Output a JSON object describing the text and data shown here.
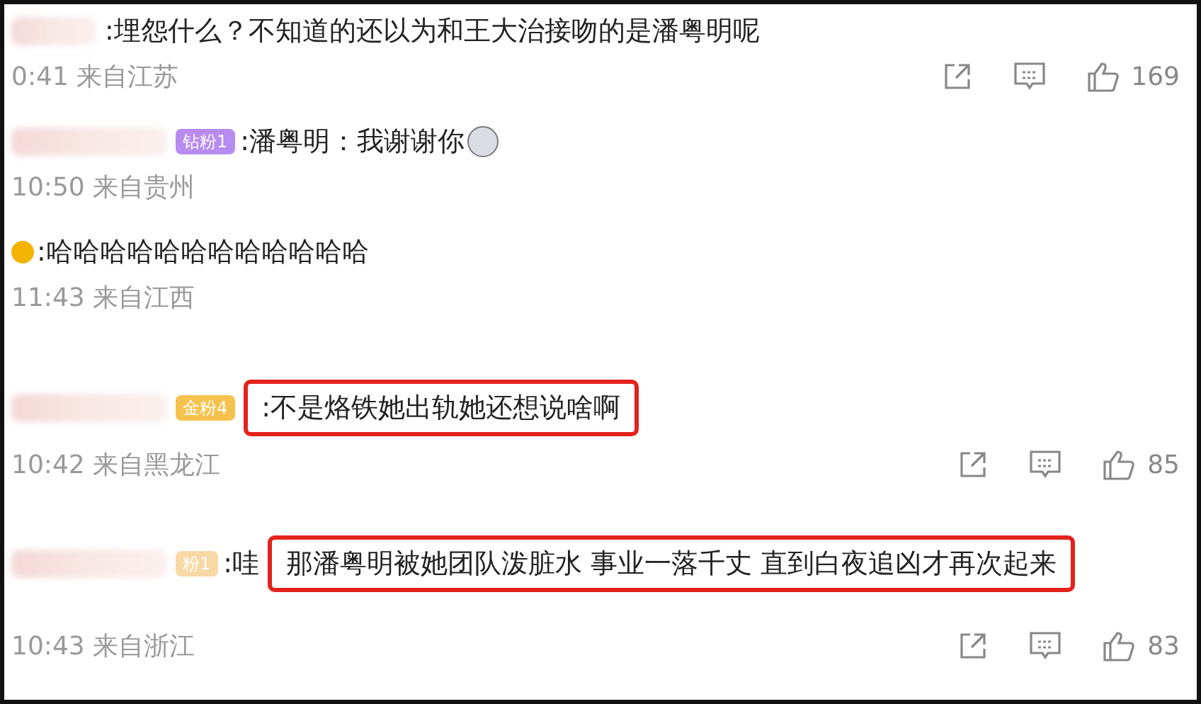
{
  "comments": [
    {
      "author": {
        "kind": "blurred"
      },
      "text": ":埋怨什么？不知道的还以为和王大治接吻的是潘粤明呢",
      "highlighted": false,
      "meta": "0:41 来自江苏",
      "likes": "169"
    },
    {
      "author": {
        "kind": "blurred"
      },
      "badge": {
        "kind": "diamond",
        "text": "钻粉1"
      },
      "text": ":潘粤明：我谢谢你",
      "emoji": true,
      "highlighted": false,
      "meta": "10:50 来自贵州"
    },
    {
      "author": {
        "kind": "verified"
      },
      "text": ":哈哈哈哈哈哈哈哈哈哈哈哈",
      "highlighted": false,
      "meta": "11:43 来自江西"
    },
    {
      "author": {
        "kind": "blurred"
      },
      "badge": {
        "kind": "gold",
        "text": "金粉4"
      },
      "text": ":不是烙铁她出轨她还想说啥啊",
      "highlighted": true,
      "meta": "10:42 来自黑龙江",
      "likes": "85"
    },
    {
      "author": {
        "kind": "blurred"
      },
      "badge": {
        "kind": "faded",
        "text": "粉1"
      },
      "prefix": ":哇",
      "text": "那潘粤明被她团队泼脏水 事业一落千丈 直到白夜追凶才再次起来",
      "highlighted": true,
      "meta": "10:43 来自浙江",
      "likes": "83"
    }
  ]
}
